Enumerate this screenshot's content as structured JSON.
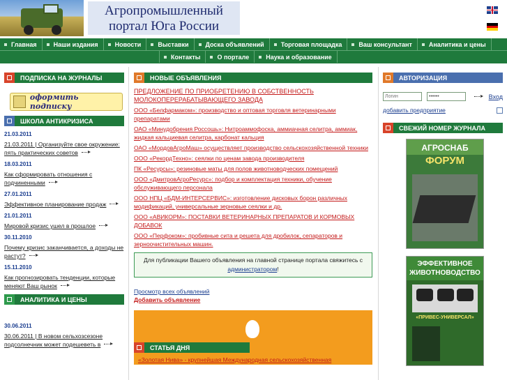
{
  "header": {
    "title_line1": "Агропромышленный",
    "title_line2": "портал Юга России"
  },
  "nav": {
    "row1": [
      "Главная",
      "Наши издания",
      "Новости",
      "Выставки",
      "Доска объявлений",
      "Торговая площадка",
      "Ваш консультант",
      "Аналитика и цены"
    ],
    "row2": [
      "Контакты",
      "О портале",
      "Наука и образование"
    ]
  },
  "left": {
    "subscription_title": "ПОДПИСКА НА ЖУРНАЛЫ",
    "subscribe_button": "оформить подписку",
    "crisis_title": "ШКОЛА АНТИКРИЗИСА",
    "news": [
      {
        "date": "21.03.2011",
        "text": "21.03.2011 | Организуйте свое окружение: пять практических советов"
      },
      {
        "date": "18.03.2011",
        "text": "Как сформировать отношения с подчиненными"
      },
      {
        "date": "27.01.2011",
        "text": "Эффективное планирование продаж"
      },
      {
        "date": "21.01.2011",
        "text": "Мировой кризис ушел в прошлое"
      },
      {
        "date": "30.11.2010",
        "text": "Почему кризис заканчивается, а доходы не растут?"
      },
      {
        "date": "15.11.2010",
        "text": "Как прогнозировать тенденции, которые меняют Ваш рынок"
      }
    ],
    "analytics_title": "АНАЛИТИКА И ЦЕНЫ",
    "analytics_news": [
      {
        "date": "30.06.2011",
        "text": "30.06.2011 | В новом сельхозсезоне подсолнечник может подешеветь в"
      }
    ]
  },
  "middle": {
    "ads_title": "НОВЫЕ ОБЪЯВЛЕНИЯ",
    "ads": [
      "ПРЕДЛОЖЕНИЕ ПО ПРИОБРЕТЕНИЮ В СОБСТВЕННОСТЬ МОЛОКОПЕРЕРАБАТЫВАЮЩЕГО ЗАВОДА",
      "ООО «Белфармаком»: производство и оптовая торговля ветеринарными препаратами",
      "ОАО «Минудобрения Россошь»: Нитроаммофоска, аммиачная селитра, аммиак, жидкая кальциевая селитра, карбонат кальция",
      "ОАО «МордовАгроМаш» осуществляет производство сельскохозяйственной техники",
      "ООО «РекордТехно»: сеялки по ценам завода производителя",
      "ПК «Ресурсы»: резиновые маты для полов животноводческих помещений",
      "ООО «ДмитровАгроРесурс»: подбор и комплектация техники, обучение обслуживающего персонала",
      "ООО НПЦ «БДМ-ИНТЕРСЕРВИС»: изготовление дисковых борон различных модификаций, универсальные зерновые сеялки и др.",
      "ООО «АВИКОРМ»: ПОСТАВКИ ВЕТЕРИНАРНЫХ ПРЕПАРАТОВ И КОРМОВЫХ ДОБАВОК",
      "ООО «Перфоком»: пробивные сита и решета для дробилок, сепараторов и зерноочистительных машин."
    ],
    "notice_text": "Для публикации Вашего объявления на главной странице портала свяжитесь с",
    "notice_link": "администратором",
    "notice_end": "!",
    "view_all": "Просмотр всех объявлений",
    "add_ad": "Добавить объявление",
    "article_title": "СТАТЬЯ ДНЯ",
    "article_text": "«Золотая Нива» - крупнейшая Международная сельскохозяйственная"
  },
  "right": {
    "auth_title": "АВТОРИЗАЦИЯ",
    "login_placeholder": "Логин",
    "password_value": "••••••",
    "enter_label": "Вход",
    "add_company": "добавить предприятие",
    "journal_title": "СВЕЖИЙ НОМЕР ЖУРНАЛА",
    "mag1_line1": "АГРОСНАБ",
    "mag1_line2": "ФОРУМ",
    "mag2_title": "ЭФФЕКТИВНОЕ ЖИВОТНОВОДСТВО",
    "mag2_sub": "«ПРИВЕС-УНИВЕРСАЛ»"
  }
}
